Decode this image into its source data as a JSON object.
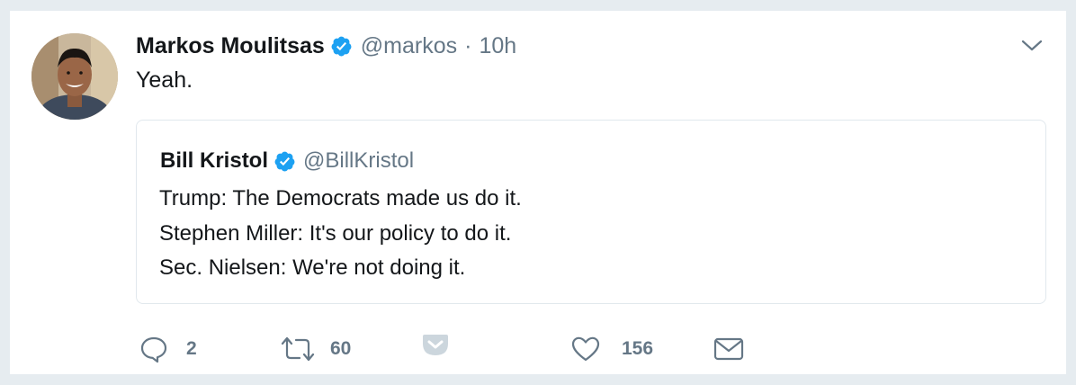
{
  "tweet": {
    "author_name": "Markos Moulitsas",
    "author_handle": "@markos",
    "separator": "·",
    "time": "10h",
    "text": "Yeah.",
    "verified_icon": "verified-badge-icon",
    "menu_icon": "chevron-down-icon"
  },
  "quoted_tweet": {
    "author_name": "Bill Kristol",
    "author_handle": "@BillKristol",
    "lines": [
      "Trump: The Democrats made us do it.",
      "Stephen Miller: It's our policy to do it.",
      "Sec. Nielsen: We're not doing it."
    ]
  },
  "actions": {
    "reply_count": "2",
    "retweet_count": "60",
    "like_count": "156"
  },
  "colors": {
    "accent": "#1da1f2",
    "muted": "#657786",
    "border": "#e1e8ed",
    "background": "#e6ecf0"
  }
}
